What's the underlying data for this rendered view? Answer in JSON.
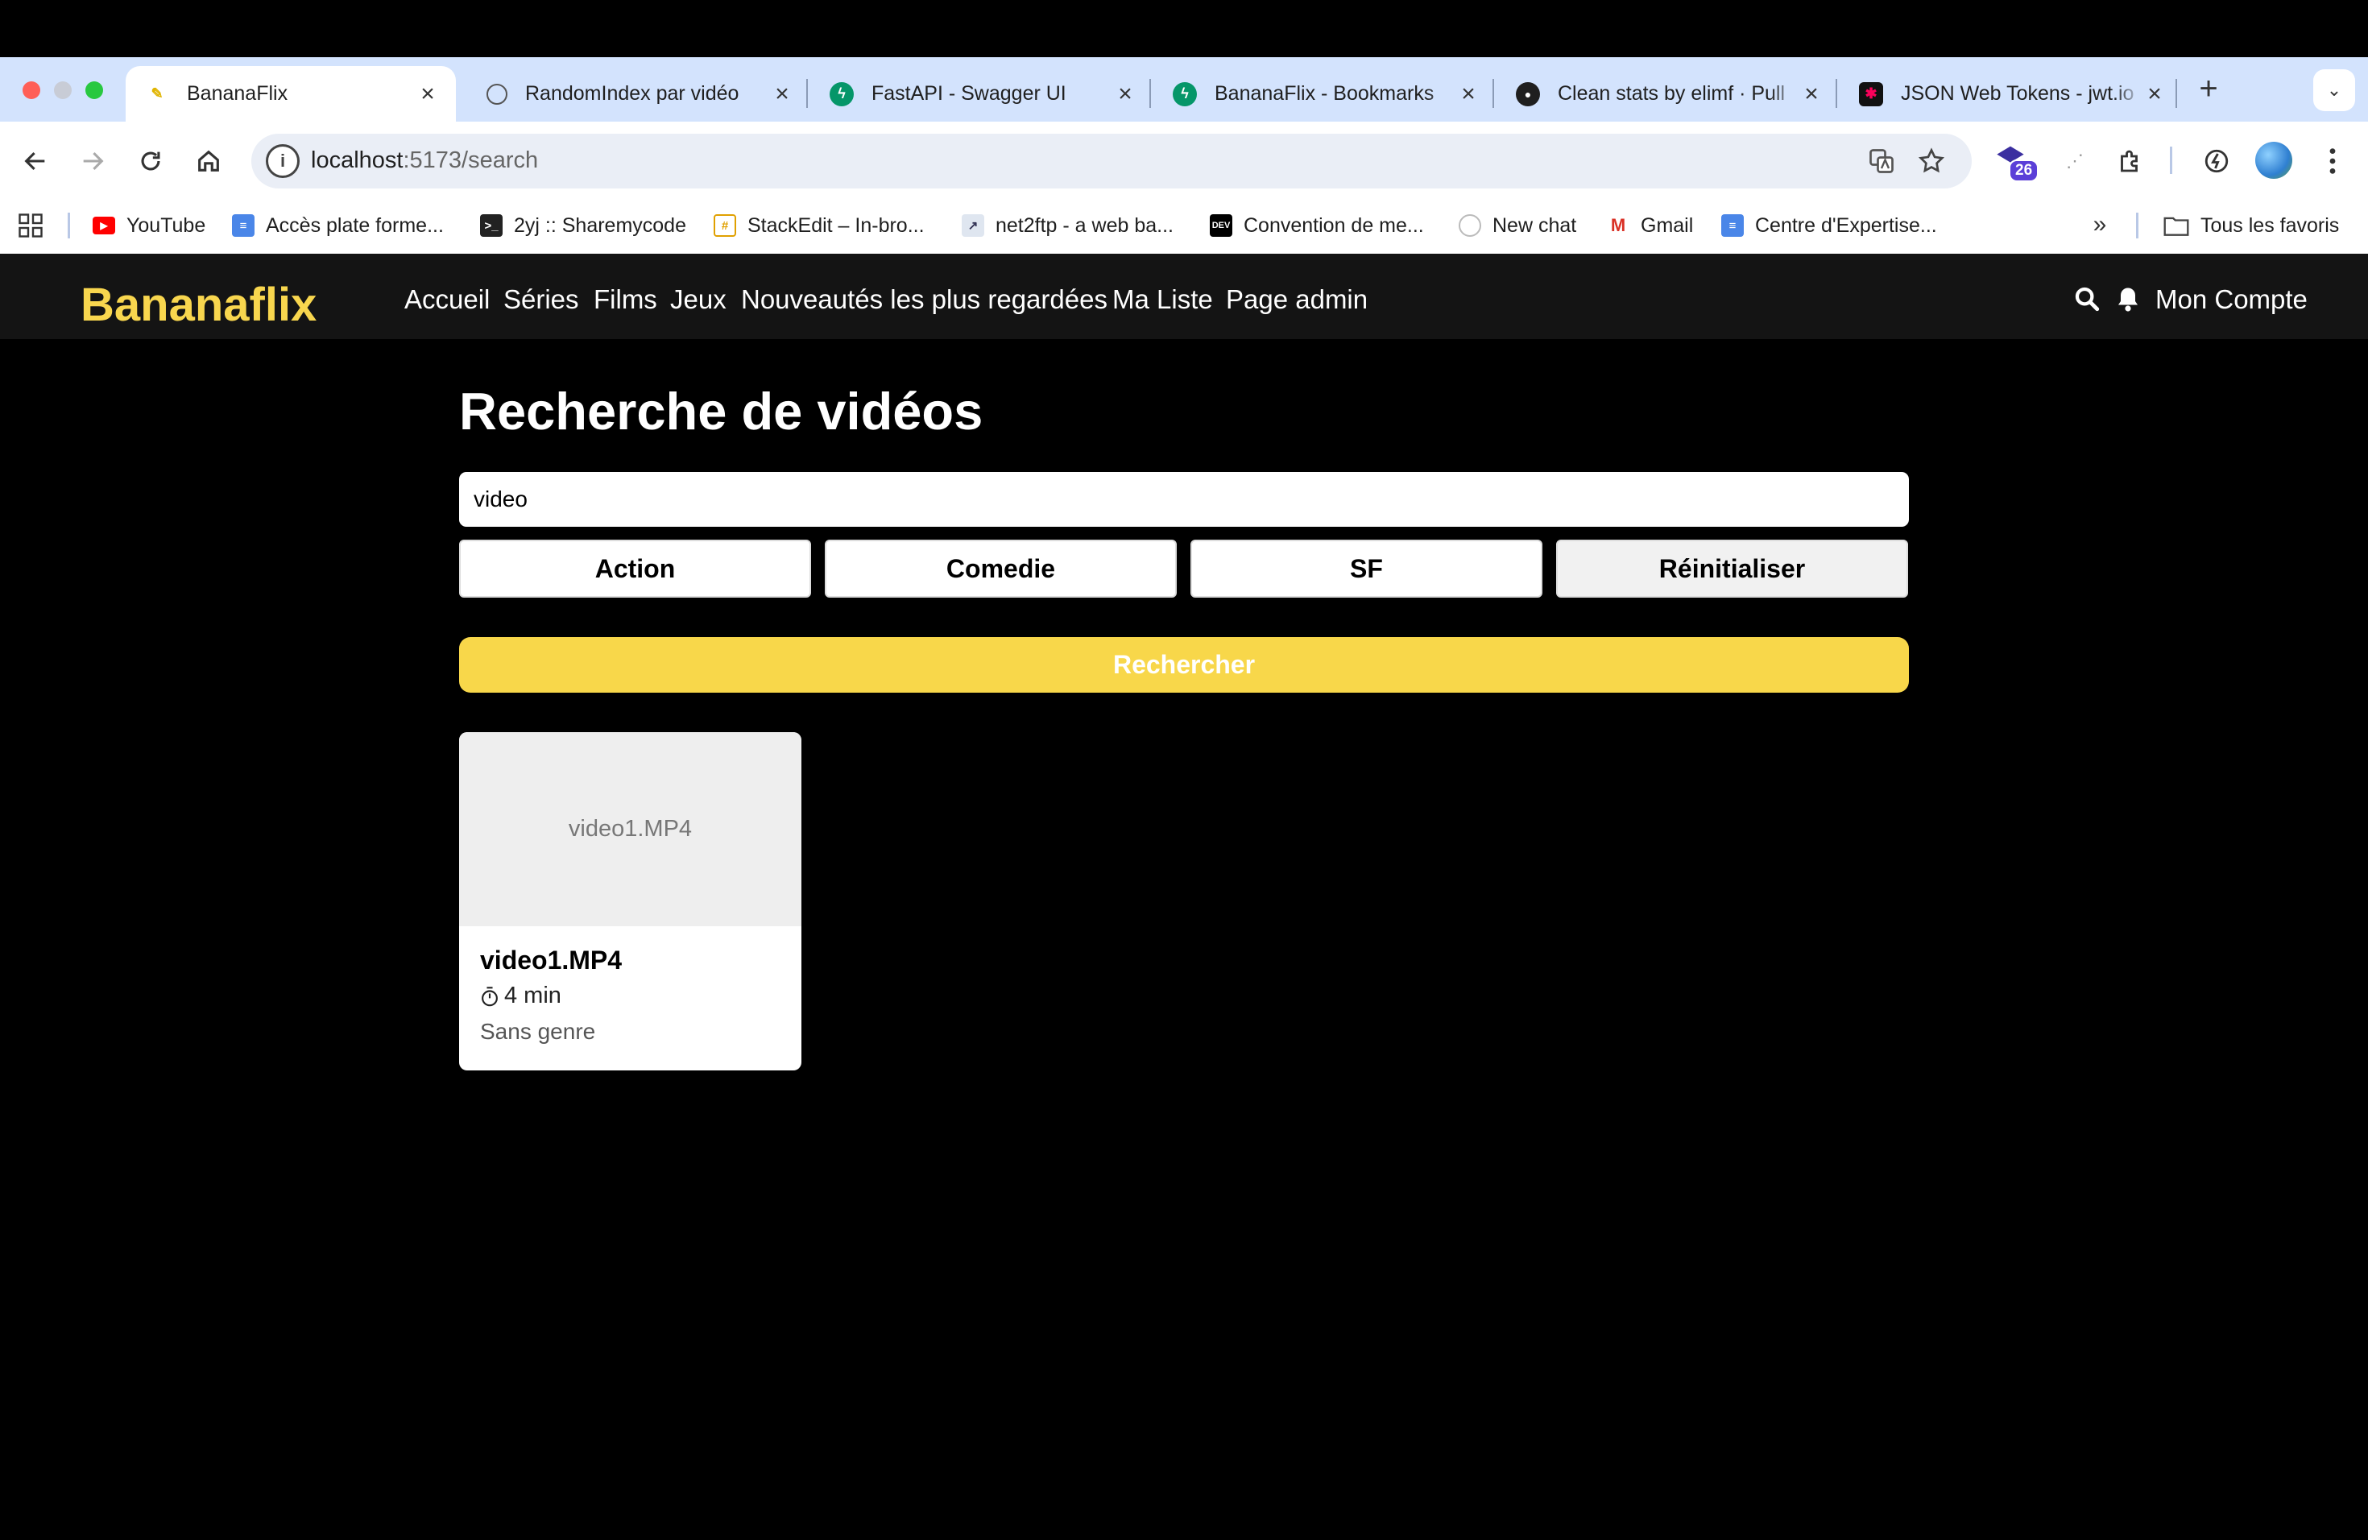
{
  "browser": {
    "tabs": [
      {
        "title": "BananaFlix",
        "active": true
      },
      {
        "title": "RandomIndex par vidéo",
        "active": false
      },
      {
        "title": "FastAPI - Swagger UI",
        "active": false
      },
      {
        "title": "BananaFlix - Bookmarks",
        "active": false
      },
      {
        "title": "Clean stats by elimf · Pull",
        "active": false
      },
      {
        "title": "JSON Web Tokens - jwt.io",
        "active": false
      }
    ],
    "url_host": "localhost",
    "url_path": ":5173/search",
    "extension_badge": "26",
    "bookmarks": [
      {
        "label": "YouTube"
      },
      {
        "label": "Accès plate forme..."
      },
      {
        "label": "2yj :: Sharemycode"
      },
      {
        "label": "StackEdit – In-bro..."
      },
      {
        "label": "net2ftp - a web ba..."
      },
      {
        "label": "Convention de me..."
      },
      {
        "label": "New chat"
      },
      {
        "label": "Gmail"
      },
      {
        "label": "Centre d'Expertise..."
      }
    ],
    "all_bookmarks": "Tous les favoris",
    "colors": {
      "tabstrip": "#d3e3fd",
      "omnibox": "#eaeef6"
    }
  },
  "app": {
    "logo": "Bananaflix",
    "nav": [
      "Accueil",
      "Séries",
      "Films",
      "Jeux",
      "Nouveautés les plus regardées",
      "Ma Liste",
      "Page admin"
    ],
    "account": "Mon Compte",
    "icons": [
      "search-icon",
      "bell-icon"
    ],
    "colors": {
      "brand": "#f8d64e",
      "navbar": "#141414",
      "background": "#000000",
      "search_button": "#f8d74a"
    }
  },
  "search": {
    "title": "Recherche de vidéos",
    "query": "video",
    "genres": [
      "Action",
      "Comedie",
      "SF"
    ],
    "reset_label": "Réinitialiser",
    "submit_label": "Rechercher"
  },
  "results": [
    {
      "thumb_text": "video1.MP4",
      "title": "video1.MP4",
      "duration": "4 min",
      "genre": "Sans genre"
    }
  ]
}
